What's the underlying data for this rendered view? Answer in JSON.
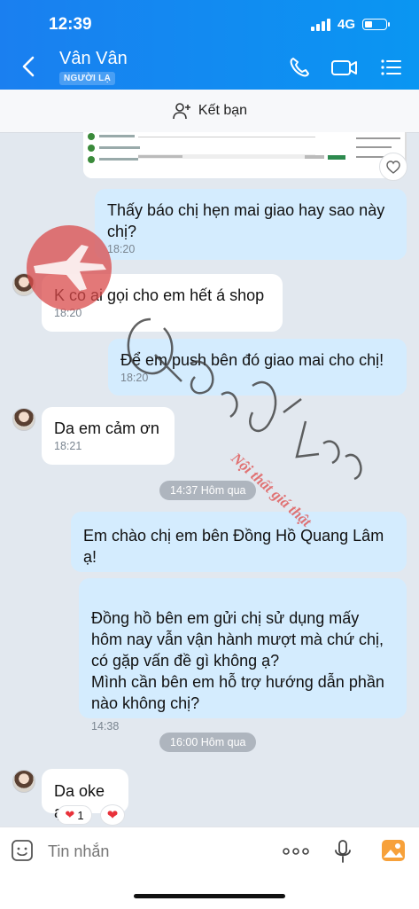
{
  "status_bar": {
    "time": "12:39",
    "network": "4G"
  },
  "header": {
    "contact_name": "Vân Vân",
    "badge": "NGƯỜI LẠ"
  },
  "add_friend": {
    "label": "Kết bạn"
  },
  "messages": [
    {
      "text": "Thấy báo chị hẹn mai giao hay sao này chị?",
      "time": "18:20"
    },
    {
      "text": "K có ai gọi cho em hết á shop",
      "time": "18:20"
    },
    {
      "text": "Để em push bên đó giao mai cho chị!",
      "time": "18:20"
    },
    {
      "text": "Da em cảm ơn",
      "time": "18:21"
    },
    {
      "text": "Em chào chị em bên Đồng Hồ Quang Lâm ạ!"
    },
    {
      "text": "Đồng hồ bên em gửi chị sử dụng mấy hôm nay vẫn vận hành mượt mà chứ chị, có gặp vấn đề gì không ạ?\nMình cần bên em hỗ trợ hướng dẫn phần nào không chị?",
      "time": "14:38"
    },
    {
      "text": "Da oke ạ"
    }
  ],
  "date_pills": [
    "14:37 Hôm qua",
    "16:00 Hôm qua"
  ],
  "reaction": {
    "count": "1"
  },
  "input": {
    "placeholder": "Tin nhắn"
  },
  "watermark": {
    "signature": "Quang Lâm",
    "tagline": "Nội thất giá thật"
  },
  "colors": {
    "header": "#0a8af2",
    "outgoing": "#d4ecfe",
    "incoming": "#ffffff",
    "background": "#e2e8ef"
  }
}
